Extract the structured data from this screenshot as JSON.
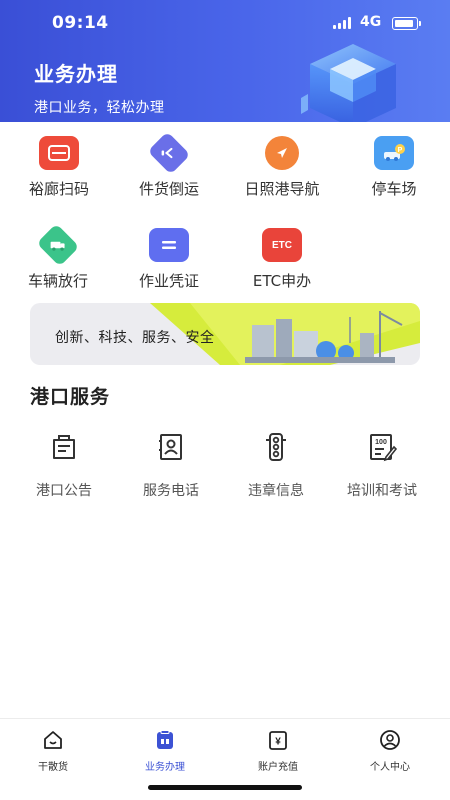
{
  "status_bar": {
    "time": "09:14",
    "network": "4G"
  },
  "header": {
    "title": "业务办理",
    "subtitle": "港口业务，轻松办理"
  },
  "quick_actions": [
    {
      "label": "裕廊扫码",
      "icon": "scan-code-icon",
      "color": "#ee4b3a"
    },
    {
      "label": "件货倒运",
      "icon": "transfer-icon",
      "color": "#6a6fe8"
    },
    {
      "label": "日照港导航",
      "icon": "navigation-icon",
      "color": "#f3843a"
    },
    {
      "label": "停车场",
      "icon": "parking-icon",
      "color": "#4a9ff2"
    },
    {
      "label": "车辆放行",
      "icon": "vehicle-release-icon",
      "color": "#3bc48a"
    },
    {
      "label": "作业凭证",
      "icon": "voucher-icon",
      "color": "#5f6ef0"
    },
    {
      "label": "ETC申办",
      "icon": "etc-icon",
      "color": "#e9443a",
      "badge": "ETC"
    }
  ],
  "banner": {
    "text": "创新、科技、服务、安全",
    "accent": "#d6ec3c"
  },
  "port_services": {
    "title": "港口服务",
    "items": [
      {
        "label": "港口公告",
        "icon": "announcement-icon"
      },
      {
        "label": "服务电话",
        "icon": "contact-book-icon"
      },
      {
        "label": "违章信息",
        "icon": "traffic-light-icon"
      },
      {
        "label": "培训和考试",
        "icon": "exam-score-icon",
        "badge": "100"
      }
    ]
  },
  "tabbar": {
    "accent": "#3c52d4",
    "tabs": [
      {
        "label": "干散货",
        "icon": "home-icon",
        "active": false
      },
      {
        "label": "业务办理",
        "icon": "clipboard-icon",
        "active": true
      },
      {
        "label": "账户充值",
        "icon": "wallet-yen-icon",
        "active": false,
        "badge": "¥"
      },
      {
        "label": "个人中心",
        "icon": "user-icon",
        "active": false
      }
    ]
  }
}
